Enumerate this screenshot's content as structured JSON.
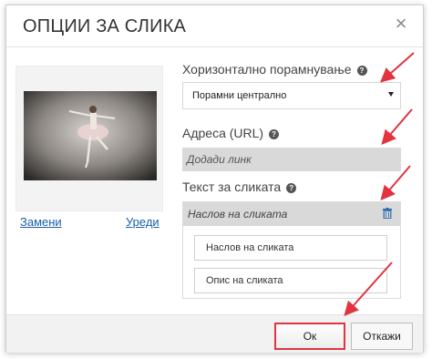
{
  "dialog": {
    "title": "ОПЦИИ ЗА СЛИКА"
  },
  "image_panel": {
    "replace_link": "Замени",
    "edit_link": "Уреди"
  },
  "alignment": {
    "label": "Хоризонтално порамнување",
    "selected": "Порамни централно"
  },
  "url": {
    "label": "Адреса (URL)",
    "placeholder": "Додади линк"
  },
  "image_text": {
    "label": "Текст за сликата",
    "header": "Наслов на сликата",
    "heading_field": "Наслов на сликата",
    "description_field": "Опис на сликата"
  },
  "footer": {
    "ok_label": "Ок",
    "cancel_label": "Откажи"
  },
  "colors": {
    "annotation_arrow": "#e1343f",
    "link": "#1a5fa8"
  }
}
